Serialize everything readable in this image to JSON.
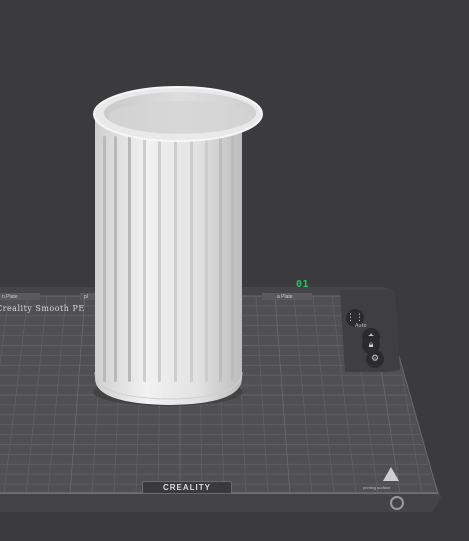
{
  "viewport": {
    "plate_number": "01",
    "bed_label": "Creality Smooth PE",
    "brand_logo": "CREALITY",
    "tabs": [
      "n Plate",
      "pl",
      "a Plate"
    ],
    "tool_label_auto": "Auto",
    "corner_label": "printing surface"
  },
  "icons": {
    "arrange": "arrange-icon",
    "auto_orient": "auto-orient-icon",
    "lock": "lock-icon",
    "settings": "gear-icon",
    "logo_triangle": "creality-triangle-icon",
    "fingerprint": "fingerprint-icon"
  },
  "colors": {
    "background": "#3b3b3d",
    "bed": "#505052",
    "grid": "#5d5d60",
    "model": "#e6e6e6",
    "plate_badge": "#22c55e"
  }
}
